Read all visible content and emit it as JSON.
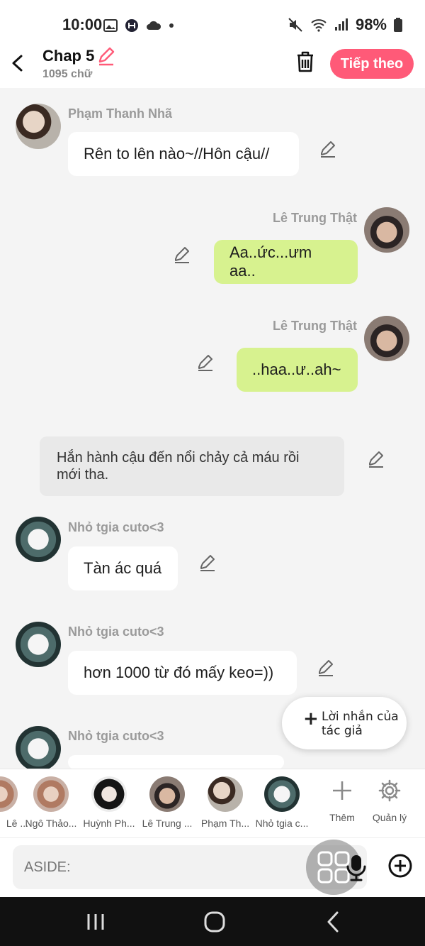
{
  "status_bar": {
    "time": "10:00",
    "battery": "98%"
  },
  "header": {
    "title": "Chap 5",
    "word_count": "1095 chữ",
    "next_label": "Tiếp theo"
  },
  "messages": [
    {
      "sender": "Phạm Thanh Nhã",
      "text": "Rên to lên nào~//Hôn cậu//"
    },
    {
      "sender": "Lê Trung Thật",
      "text": "Aa..ức...ưm aa.."
    },
    {
      "sender": "Lê Trung Thật",
      "text": "..haa..ư..ah~"
    },
    {
      "sender": "Nhỏ tgia cuto<3",
      "text": "Tàn ác quá"
    },
    {
      "sender": "Nhỏ tgia cuto<3",
      "text": "hơn 1000 từ đó mấy keo=))"
    },
    {
      "sender": "Nhỏ tgia cuto<3",
      "text": ""
    }
  ],
  "narration": "Hắn hành cậu đến nổi chảy cả máu rồi mới tha.",
  "author_note": {
    "label": "Lời nhắn của tác giả"
  },
  "characters": [
    {
      "name": "Lê ..."
    },
    {
      "name": "Ngô Thảo..."
    },
    {
      "name": "Huỳnh Ph..."
    },
    {
      "name": "Lê Trung ..."
    },
    {
      "name": "Phạm Th..."
    },
    {
      "name": "Nhỏ tgia c..."
    }
  ],
  "strip_actions": {
    "add_label": "Thêm",
    "manage_label": "Quản lý"
  },
  "input": {
    "placeholder": "ASIDE:"
  },
  "colors": {
    "accent": "#ff5a78",
    "green_bubble": "#d7f28f"
  }
}
